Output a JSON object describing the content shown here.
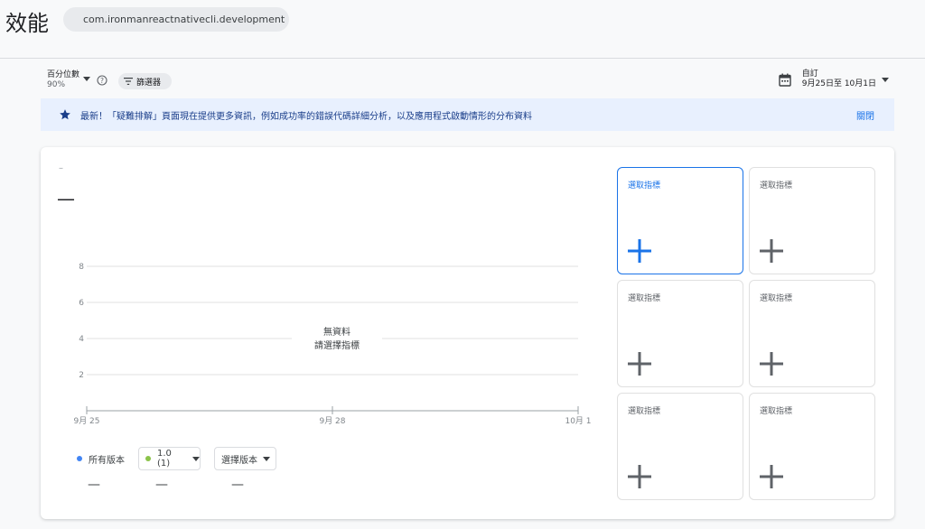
{
  "header": {
    "title": "效能",
    "app_name": "com.ironmanreactnativecli.development"
  },
  "toolbar": {
    "percentile_label": "百分位數",
    "percentile_value": "90%",
    "filter_label": "篩選器",
    "date_label": "自訂",
    "date_range": "9月25日至 10月1日"
  },
  "banner": {
    "text": "最新！「疑難排解」頁面現在提供更多資訊，例如成功率的錯誤代碼詳細分析，以及應用程式啟動情形的分布資料",
    "close_label": "關閉"
  },
  "metric": {
    "small_value": "–",
    "big_value": "—"
  },
  "chart_data": {
    "type": "line",
    "x_ticks": [
      "9月 25",
      "9月 28",
      "10月 1"
    ],
    "y_ticks": [
      2,
      4,
      6,
      8
    ],
    "ylim": [
      0,
      8
    ],
    "series": [],
    "empty_title": "無資料",
    "empty_subtitle": "請選擇指標"
  },
  "legend": {
    "all_versions_label": "所有版本",
    "version_label": "1.0 (1)",
    "select_version_label": "選擇版本",
    "all_versions_value": "—",
    "version_value": "—",
    "select_version_value": "—",
    "colors": {
      "all": "#4285f4",
      "version": "#8bc34a"
    }
  },
  "tiles": [
    {
      "label": "選取指標",
      "selected": true
    },
    {
      "label": "選取指標",
      "selected": false
    },
    {
      "label": "選取指標",
      "selected": false
    },
    {
      "label": "選取指標",
      "selected": false
    },
    {
      "label": "選取指標",
      "selected": false
    },
    {
      "label": "選取指標",
      "selected": false
    }
  ]
}
